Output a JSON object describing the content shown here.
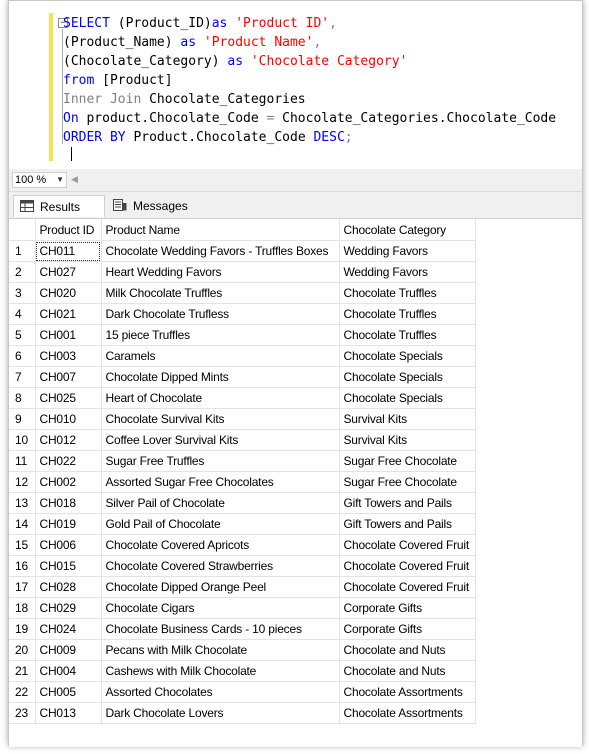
{
  "editor": {
    "collapse_glyph": "−",
    "lines": [
      [
        {
          "t": "SELECT ",
          "c": "kw"
        },
        {
          "t": "(Product_ID)",
          "c": ""
        },
        {
          "t": "as ",
          "c": "kw"
        },
        {
          "t": "'Product ID'",
          "c": "str"
        },
        {
          "t": ",",
          "c": "gray"
        }
      ],
      [
        {
          "t": "(Product_Name) ",
          "c": ""
        },
        {
          "t": "as ",
          "c": "kw"
        },
        {
          "t": "'Product Name'",
          "c": "str"
        },
        {
          "t": ",",
          "c": "gray"
        }
      ],
      [
        {
          "t": "(Chocolate_Category) ",
          "c": ""
        },
        {
          "t": "as ",
          "c": "kw"
        },
        {
          "t": "'Chocolate Category'",
          "c": "str"
        }
      ],
      [
        {
          "t": "from ",
          "c": "kw"
        },
        {
          "t": "[Product]",
          "c": ""
        }
      ],
      [
        {
          "t": "Inner Join ",
          "c": "gray"
        },
        {
          "t": "Chocolate_Categories",
          "c": ""
        }
      ],
      [
        {
          "t": "On ",
          "c": "kw"
        },
        {
          "t": "product.Chocolate_Code ",
          "c": ""
        },
        {
          "t": "= ",
          "c": "gray"
        },
        {
          "t": "Chocolate_Categories.Chocolate_Code",
          "c": ""
        }
      ],
      [
        {
          "t": "ORDER BY ",
          "c": "kw"
        },
        {
          "t": "Product.Chocolate_Code ",
          "c": ""
        },
        {
          "t": "DESC",
          "c": "kw"
        },
        {
          "t": ";",
          "c": "gray"
        }
      ],
      []
    ]
  },
  "zoom": {
    "value": "100 %"
  },
  "tabs": {
    "results": "Results",
    "messages": "Messages"
  },
  "grid": {
    "headers": [
      "",
      "Product ID",
      "Product Name",
      "Chocolate Category"
    ],
    "rows": [
      [
        "1",
        "CH011",
        "Chocolate Wedding Favors - Truffles Boxes",
        "Wedding Favors"
      ],
      [
        "2",
        "CH027",
        "Heart Wedding Favors",
        "Wedding Favors"
      ],
      [
        "3",
        "CH020",
        "Milk Chocolate Truffles",
        "Chocolate Truffles"
      ],
      [
        "4",
        "CH021",
        "Dark Chocolate Trufless",
        "Chocolate Truffles"
      ],
      [
        "5",
        "CH001",
        "15 piece Truffles",
        "Chocolate Truffles"
      ],
      [
        "6",
        "CH003",
        "Caramels",
        "Chocolate Specials"
      ],
      [
        "7",
        "CH007",
        "Chocolate Dipped Mints",
        "Chocolate Specials"
      ],
      [
        "8",
        "CH025",
        "Heart of Chocolate",
        "Chocolate Specials"
      ],
      [
        "9",
        "CH010",
        "Chocolate Survival Kits",
        "Survival Kits"
      ],
      [
        "10",
        "CH012",
        "Coffee Lover Survival Kits",
        "Survival Kits"
      ],
      [
        "11",
        "CH022",
        "Sugar Free Truffles",
        "Sugar Free Chocolate"
      ],
      [
        "12",
        "CH002",
        "Assorted Sugar Free Chocolates",
        "Sugar Free Chocolate"
      ],
      [
        "13",
        "CH018",
        "Silver Pail of Chocolate",
        "Gift Towers and Pails"
      ],
      [
        "14",
        "CH019",
        "Gold Pail of Chocolate",
        "Gift Towers and Pails"
      ],
      [
        "15",
        "CH006",
        "Chocolate Covered Apricots",
        "Chocolate Covered Fruit"
      ],
      [
        "16",
        "CH015",
        "Chocolate Covered Strawberries",
        "Chocolate Covered Fruit"
      ],
      [
        "17",
        "CH028",
        "Chocolate Dipped Orange Peel",
        "Chocolate Covered Fruit"
      ],
      [
        "18",
        "CH029",
        "Chocolate Cigars",
        "Corporate Gifts"
      ],
      [
        "19",
        "CH024",
        "Chocolate Business Cards - 10 pieces",
        "Corporate Gifts"
      ],
      [
        "20",
        "CH009",
        "Pecans with Milk Chocolate",
        "Chocolate and Nuts"
      ],
      [
        "21",
        "CH004",
        "Cashews with Milk Chocolate",
        "Chocolate and Nuts"
      ],
      [
        "22",
        "CH005",
        "Assorted Chocolates",
        "Chocolate Assortments"
      ],
      [
        "23",
        "CH013",
        "Dark Chocolate Lovers",
        "Chocolate Assortments"
      ]
    ]
  },
  "colors": {
    "keyword": "#0000ff",
    "string": "#ff0000",
    "operator": "#808080",
    "margin_bar": "#f2e25a"
  }
}
